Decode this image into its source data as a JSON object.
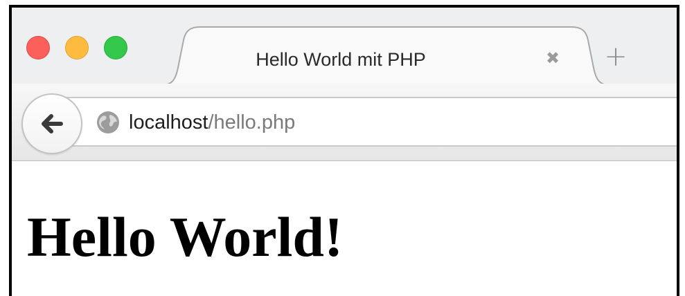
{
  "window": {
    "traffic_lights": {
      "close_color": "#fc605b",
      "minimize_color": "#fdbc40",
      "maximize_color": "#34c84a"
    }
  },
  "tab": {
    "title": "Hello World mit PHP",
    "close_glyph": "✖",
    "new_tab_glyph": "+"
  },
  "address_bar": {
    "host": "localhost",
    "path": "/hello.php",
    "back_icon": "back-arrow-icon",
    "site_icon": "globe-icon"
  },
  "page": {
    "heading": "Hello World!"
  }
}
